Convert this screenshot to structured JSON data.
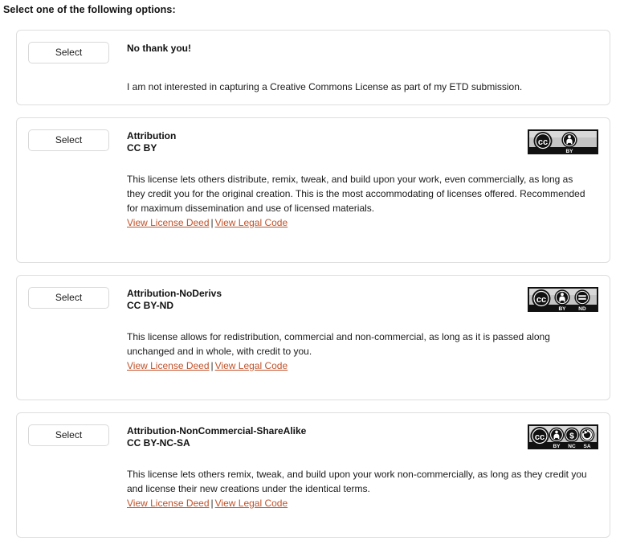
{
  "page": {
    "title": "Select one of the following options:"
  },
  "common": {
    "select_label": "Select",
    "deed_label": "View License Deed",
    "legal_label": "View Legal Code",
    "link_separator": "|",
    "link_color": "#c0522a",
    "card_border_color": "#dedede",
    "badge_bg_dark": "#111111",
    "badge_bg_light": "#c9c9c9"
  },
  "options": [
    {
      "select_label": "Select",
      "name": "No thank you!",
      "code": "",
      "description": "I am not interested in capturing a Creative Commons License as part of my ETD submission.",
      "has_links": false,
      "badge": null
    },
    {
      "select_label": "Select",
      "name": "Attribution",
      "code": "CC BY",
      "description": "This license lets others distribute, remix, tweak, and build upon your work, even commercially, as long as they credit you for the original creation. This is the most accommodating of licenses offered. Recommended for maximum dissemination and use of licensed materials.",
      "has_links": true,
      "deed_label": "View License Deed",
      "legal_label": "View Legal Code",
      "badge": {
        "icons": [
          "cc-icon",
          "by-icon"
        ],
        "labels": [
          "BY"
        ]
      }
    },
    {
      "select_label": "Select",
      "name": "Attribution-NoDerivs",
      "code": "CC BY-ND",
      "description": "This license allows for redistribution, commercial and non-commercial, as long as it is passed along unchanged and in whole, with credit to you.",
      "has_links": true,
      "deed_label": "View License Deed",
      "legal_label": "View Legal Code",
      "badge": {
        "icons": [
          "cc-icon",
          "by-icon",
          "nd-icon"
        ],
        "labels": [
          "BY",
          "ND"
        ]
      }
    },
    {
      "select_label": "Select",
      "name": "Attribution-NonCommercial-ShareAlike",
      "code": "CC BY-NC-SA",
      "description": "This license lets others remix, tweak, and build upon your work non-commercially, as long as they credit you and license their new creations under the identical terms.",
      "has_links": true,
      "deed_label": "View License Deed",
      "legal_label": "View Legal Code",
      "badge": {
        "icons": [
          "cc-icon",
          "by-icon",
          "nc-icon",
          "sa-icon"
        ],
        "labels": [
          "BY",
          "NC",
          "SA"
        ]
      }
    }
  ]
}
